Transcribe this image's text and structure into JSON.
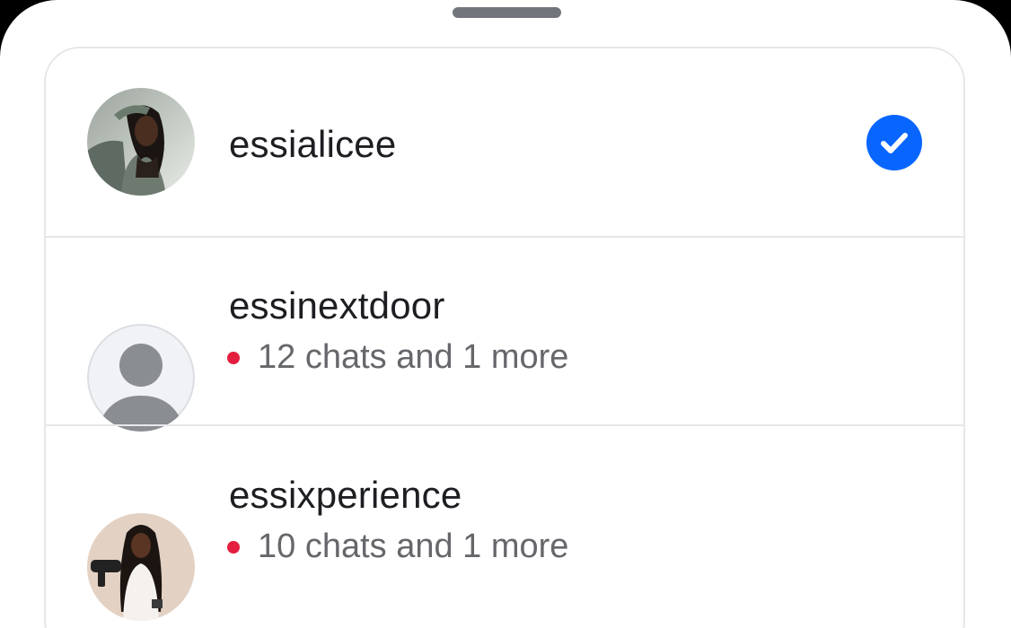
{
  "accounts": [
    {
      "username": "essialicee",
      "selected": true,
      "avatar": "photo-avatar"
    },
    {
      "username": "essinextdoor",
      "notification": "12 chats and 1 more",
      "avatar": "default-avatar"
    },
    {
      "username": "essixperience",
      "notification": "10 chats and 1 more",
      "avatar": "photo-avatar"
    }
  ],
  "colors": {
    "accent": "#0866ff",
    "notification_dot": "#e41e3f",
    "text_primary": "#1c1e21",
    "text_secondary": "#65676b",
    "divider": "#e6e7eb"
  }
}
